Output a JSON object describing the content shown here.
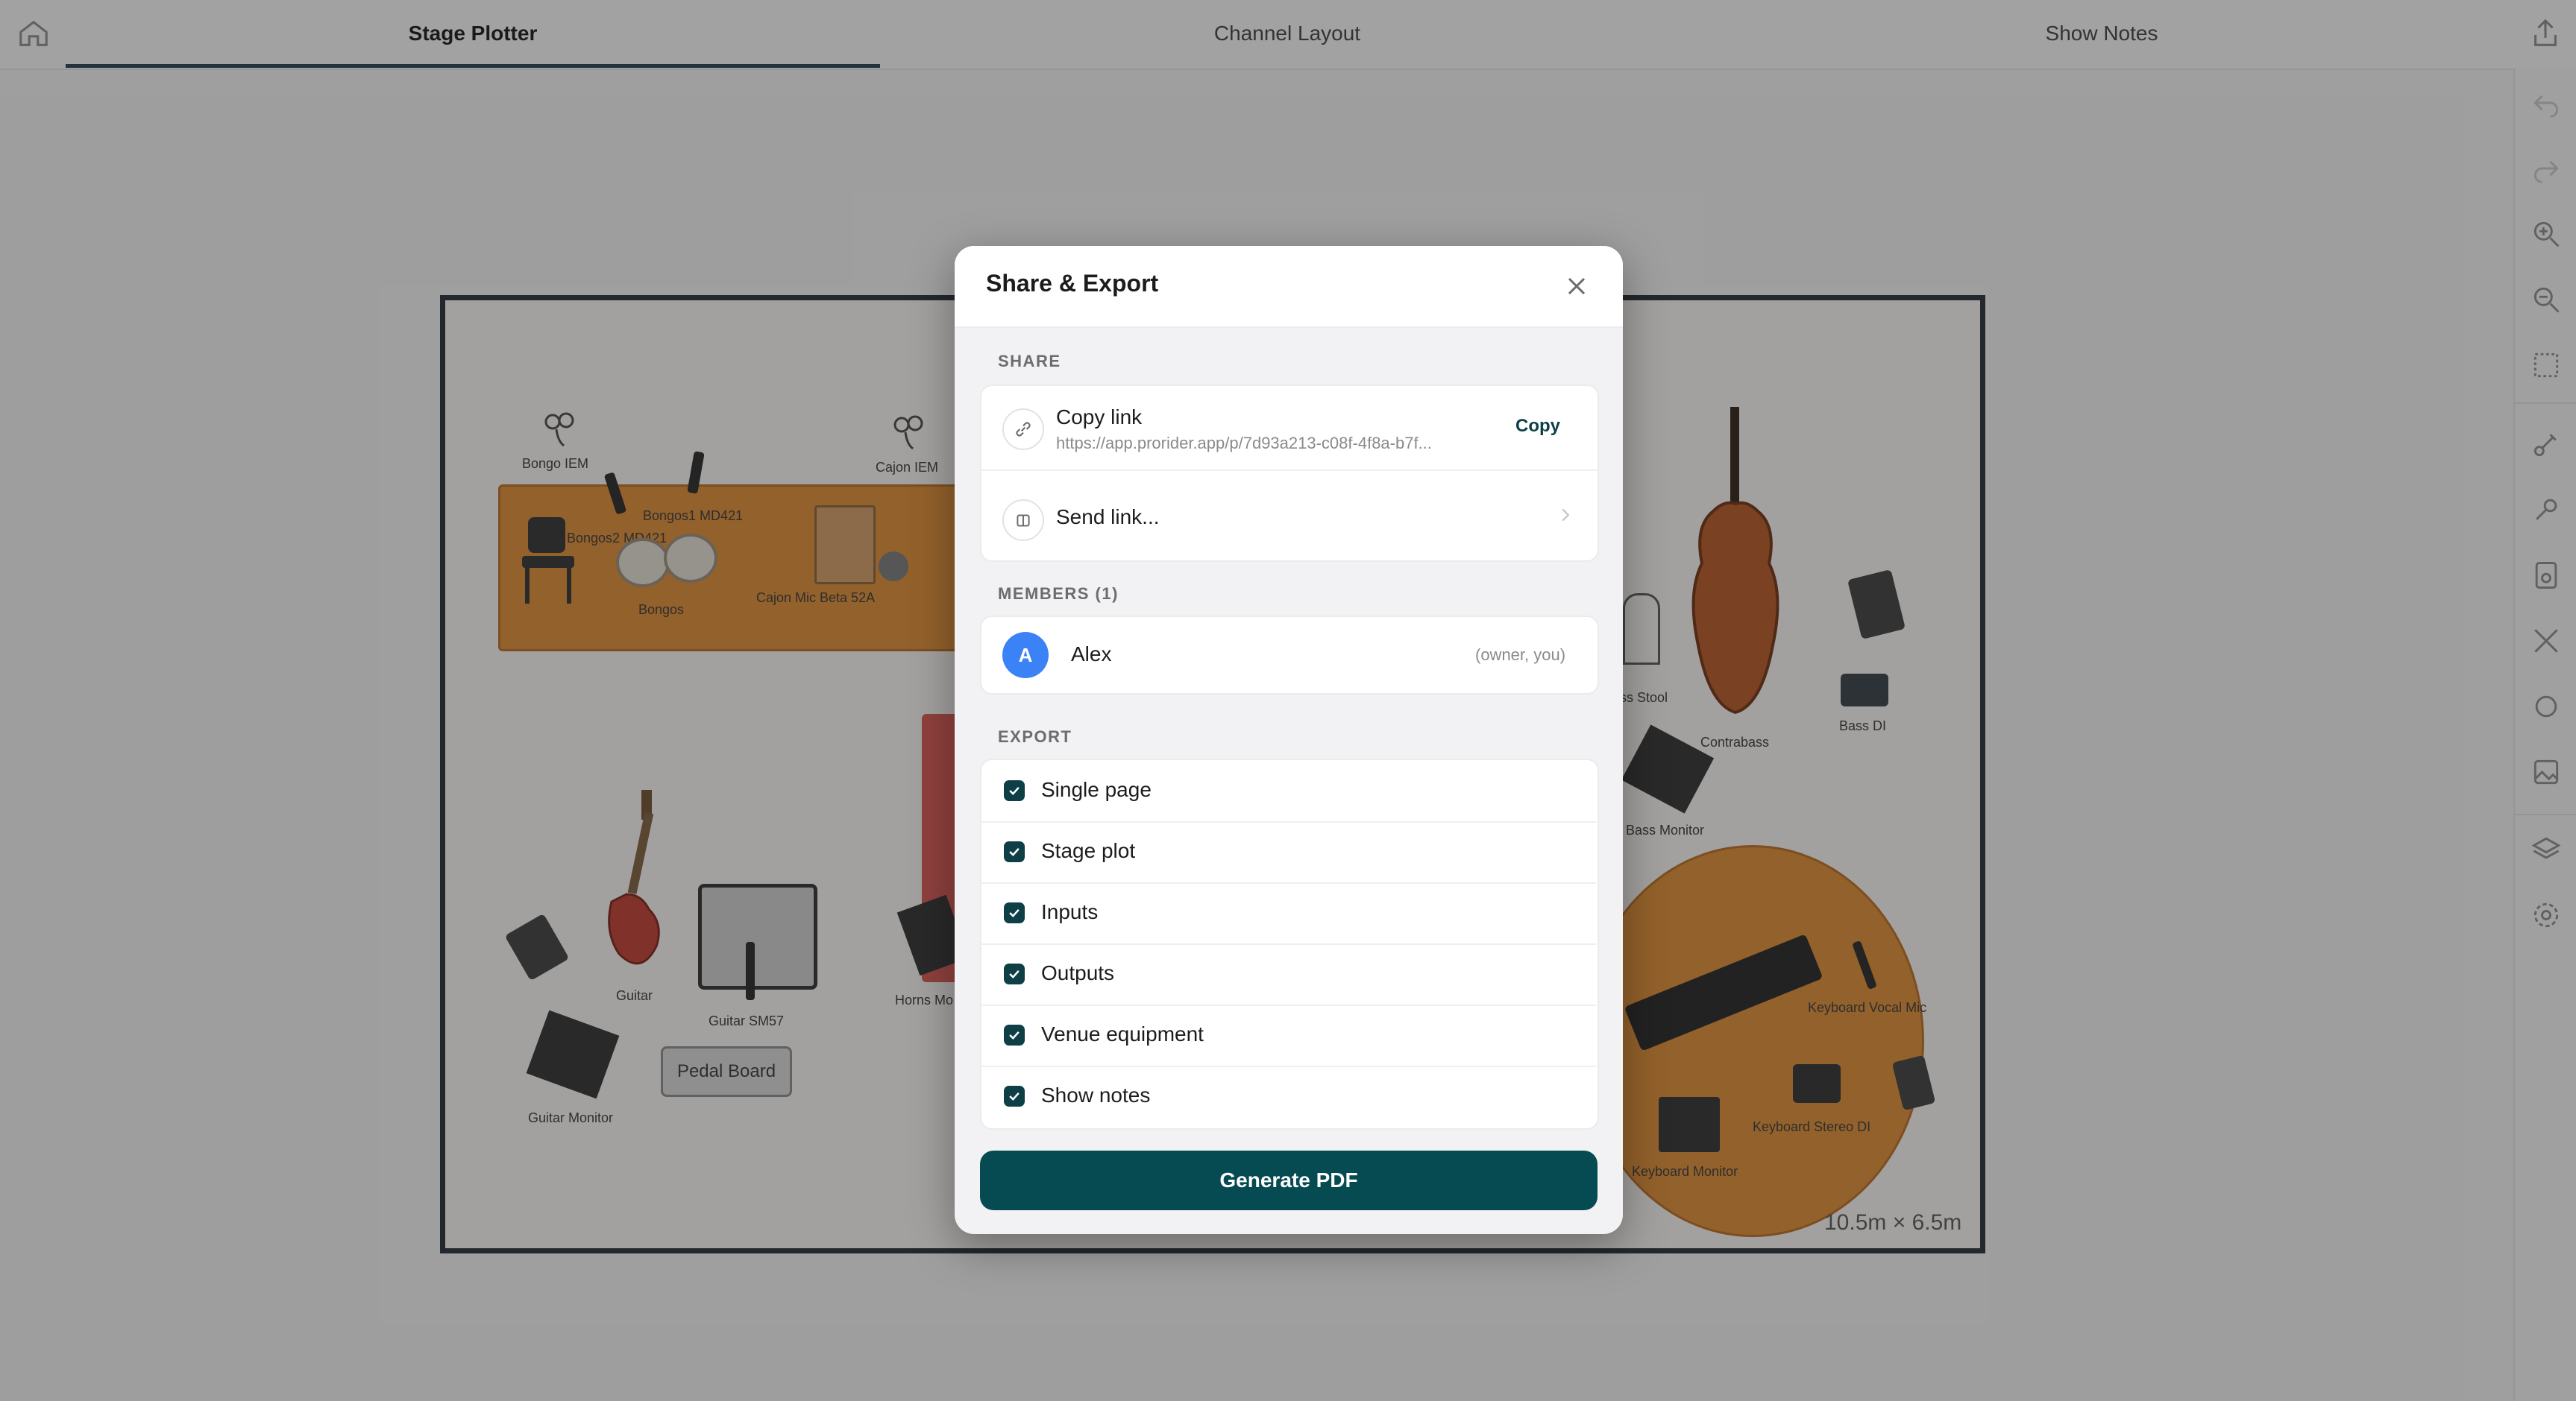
{
  "tabs": [
    {
      "label": "Stage Plotter",
      "active": true
    },
    {
      "label": "Channel Layout",
      "active": false
    },
    {
      "label": "Show Notes",
      "active": false
    }
  ],
  "top_icons": [
    "home-icon",
    "share-icon"
  ],
  "rail_icons": [
    "undo-icon",
    "redo-icon",
    "zoom-in-icon",
    "zoom-out-icon",
    "select-area-icon",
    "cable-icon",
    "microphone-icon",
    "speaker-icon",
    "tools-icon",
    "circle-icon",
    "image-icon",
    "layers-icon",
    "settings-icon"
  ],
  "stage": {
    "dimensions": "10.5m × 6.5m",
    "riser_color": "#e08a2d",
    "items": {
      "bongo_iem": "Bongo IEM",
      "cajon_iem": "Cajon IEM",
      "bongos1_mic": "Bongos1 MD421",
      "bongos2_mic": "Bongos2 MD421",
      "bongos": "Bongos",
      "cajon_mic": "Cajon Mic Beta 52A",
      "guitar": "Guitar",
      "guitar_mic": "Guitar SM57",
      "guitar_monitor": "Guitar Monitor",
      "pedal_board": "Pedal Board",
      "horns_monitor": "Horns Mo",
      "bass_stool": "ss Stool",
      "contrabass": "Contrabass",
      "bass_di": "Bass DI",
      "bass_monitor": "Bass Monitor",
      "keyboard_vocal_mic": "Keyboard Vocal Mic",
      "keyboard_stereo_di": "Keyboard Stereo DI",
      "keyboard_monitor": "Keyboard Monitor"
    }
  },
  "modal": {
    "title": "Share & Export",
    "share_section": "SHARE",
    "copy_link": {
      "label": "Copy link",
      "url": "https://app.prorider.app/p/7d93a213-c08f-4f8a-b7f...",
      "action": "Copy"
    },
    "send_link": {
      "label": "Send link..."
    },
    "members_section": "MEMBERS (1)",
    "members": [
      {
        "initial": "A",
        "name": "Alex",
        "role": "(owner, you)",
        "avatar_color": "#3b82f6"
      }
    ],
    "export_section": "EXPORT",
    "export_options": [
      {
        "label": "Single page",
        "checked": true
      },
      {
        "label": "Stage plot",
        "checked": true
      },
      {
        "label": "Inputs",
        "checked": true
      },
      {
        "label": "Outputs",
        "checked": true
      },
      {
        "label": "Venue equipment",
        "checked": true
      },
      {
        "label": "Show notes",
        "checked": true
      }
    ],
    "generate_button": "Generate PDF",
    "accent_color": "#064b52"
  }
}
